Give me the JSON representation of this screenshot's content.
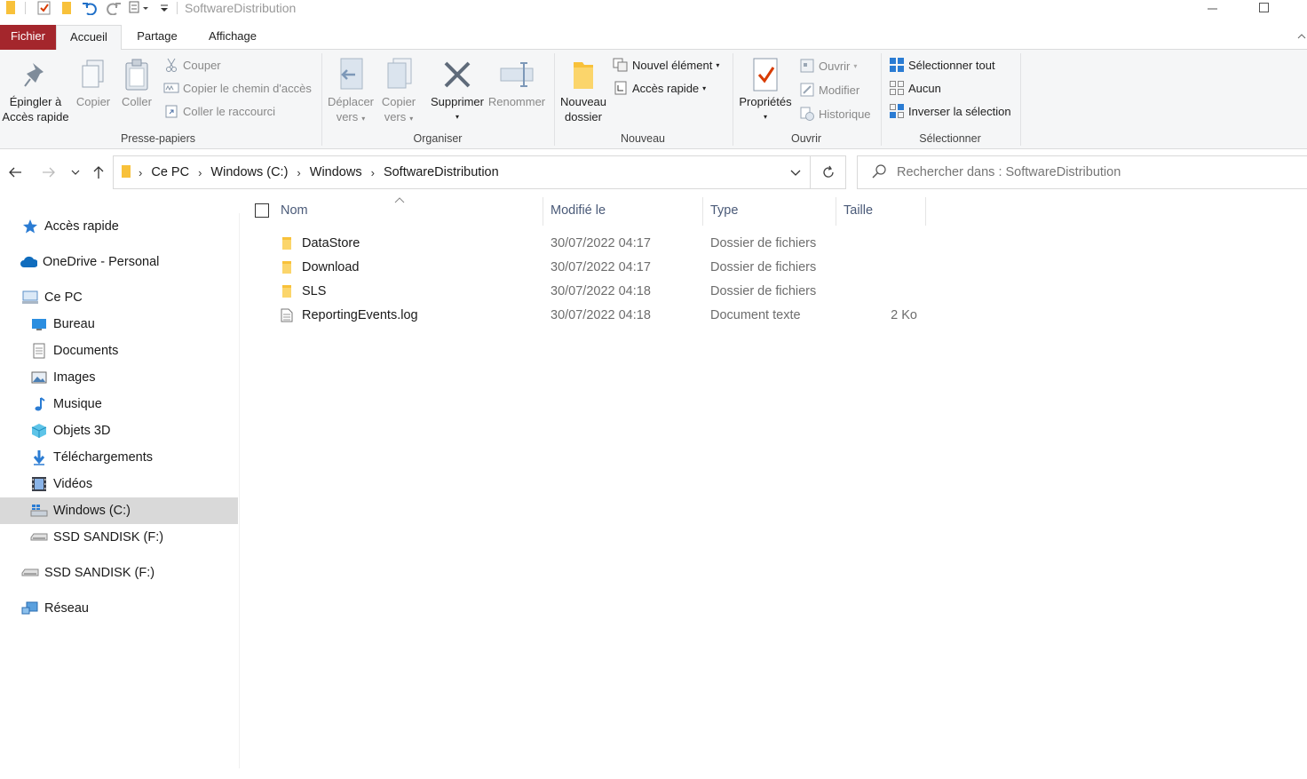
{
  "window": {
    "title": "SoftwareDistribution"
  },
  "ribbon_tabs": [
    "Fichier",
    "Accueil",
    "Partage",
    "Affichage"
  ],
  "clipboard": {
    "pin_line1": "Épingler à",
    "pin_line2": "Accès rapide",
    "copy": "Copier",
    "paste": "Coller",
    "cut": "Couper",
    "copy_path": "Copier le chemin d'accès",
    "paste_shortcut": "Coller le raccourci",
    "label": "Presse-papiers"
  },
  "organize": {
    "move_line1": "Déplacer",
    "move_line2": "vers",
    "copyto_line1": "Copier",
    "copyto_line2": "vers",
    "delete": "Supprimer",
    "rename": "Renommer",
    "label": "Organiser"
  },
  "new": {
    "folder_line1": "Nouveau",
    "folder_line2": "dossier",
    "new_item": "Nouvel élément",
    "easy_access": "Accès rapide",
    "label": "Nouveau"
  },
  "open": {
    "properties": "Propriétés",
    "open": "Ouvrir",
    "edit": "Modifier",
    "history": "Historique",
    "label": "Ouvrir"
  },
  "select": {
    "all": "Sélectionner tout",
    "none": "Aucun",
    "invert": "Inverser la sélection",
    "label": "Sélectionner"
  },
  "breadcrumb": [
    "Ce PC",
    "Windows (C:)",
    "Windows",
    "SoftwareDistribution"
  ],
  "search": {
    "placeholder": "Rechercher dans : SoftwareDistribution"
  },
  "sidebar": {
    "items": [
      {
        "label": "Accès rapide",
        "icon": "star-icon"
      },
      {
        "label": "OneDrive - Personal",
        "icon": "cloud-icon"
      },
      {
        "label": "Ce PC",
        "icon": "computer-icon"
      },
      {
        "label": "Bureau",
        "icon": "desktop-icon"
      },
      {
        "label": "Documents",
        "icon": "documents-icon"
      },
      {
        "label": "Images",
        "icon": "images-icon"
      },
      {
        "label": "Musique",
        "icon": "music-icon"
      },
      {
        "label": "Objets 3D",
        "icon": "3d-objects-icon"
      },
      {
        "label": "Téléchargements",
        "icon": "downloads-icon"
      },
      {
        "label": "Vidéos",
        "icon": "videos-icon"
      },
      {
        "label": "Windows (C:)",
        "icon": "windows-drive-icon",
        "selected": true
      },
      {
        "label": "SSD SANDISK (F:)",
        "icon": "drive-icon"
      },
      {
        "label": "SSD SANDISK (F:)",
        "icon": "drive-icon"
      },
      {
        "label": "Réseau",
        "icon": "network-icon"
      }
    ]
  },
  "columns": {
    "name": "Nom",
    "modified": "Modifié le",
    "type": "Type",
    "size": "Taille"
  },
  "files": [
    {
      "name": "DataStore",
      "modified": "30/07/2022 04:17",
      "type": "Dossier de fichiers",
      "size": "",
      "icon": "folder-icon"
    },
    {
      "name": "Download",
      "modified": "30/07/2022 04:17",
      "type": "Dossier de fichiers",
      "size": "",
      "icon": "folder-icon"
    },
    {
      "name": "SLS",
      "modified": "30/07/2022 04:18",
      "type": "Dossier de fichiers",
      "size": "",
      "icon": "folder-icon"
    },
    {
      "name": "ReportingEvents.log",
      "modified": "30/07/2022 04:18",
      "type": "Document texte",
      "size": "2 Ko",
      "icon": "text-file-icon"
    }
  ],
  "colors": {
    "file_tab": "#a4262c",
    "accent": "#0078d4",
    "folder": "#f8c13a"
  }
}
